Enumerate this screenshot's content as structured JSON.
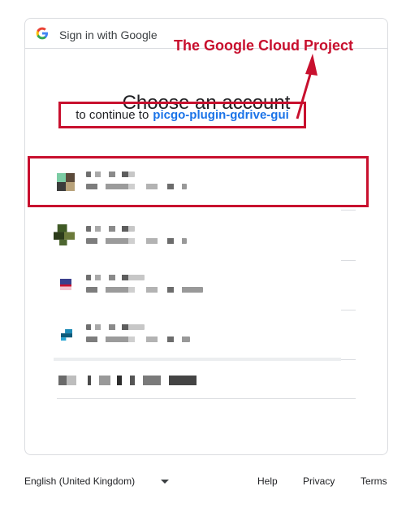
{
  "header": {
    "text": "Sign in with Google",
    "logo_icon": "google-g-icon"
  },
  "title": "Choose an account",
  "subtitle": {
    "prefix": "to continue to",
    "project": "picgo-plugin-gdrive-gui"
  },
  "annotation": {
    "text": "The Google Cloud Project",
    "color": "#c8102e"
  },
  "accounts": [
    {
      "avatar_colors": [
        "#7ccca4",
        "#8a6a4a",
        "#3c3c3c"
      ],
      "highlighted": true
    },
    {
      "avatar_colors": [
        "#3f5a25",
        "#6b7a3a",
        "#2c3b1a"
      ],
      "highlighted": false
    },
    {
      "avatar_colors": [
        "#3a3f8c",
        "#c8102e",
        "#f4c4cf"
      ],
      "highlighted": false
    },
    {
      "avatar_colors": [
        "#1e8bb6",
        "#0c5a7a",
        "#2aa6d4"
      ],
      "highlighted": false
    }
  ],
  "use_another_account": {
    "icon": "redacted-text-icon"
  },
  "footer": {
    "language": "English (United Kingdom)",
    "help": "Help",
    "privacy": "Privacy",
    "terms": "Terms"
  },
  "colors": {
    "accent": "#1a73e8",
    "annotation_red": "#c8102e",
    "border": "#dadce0"
  }
}
